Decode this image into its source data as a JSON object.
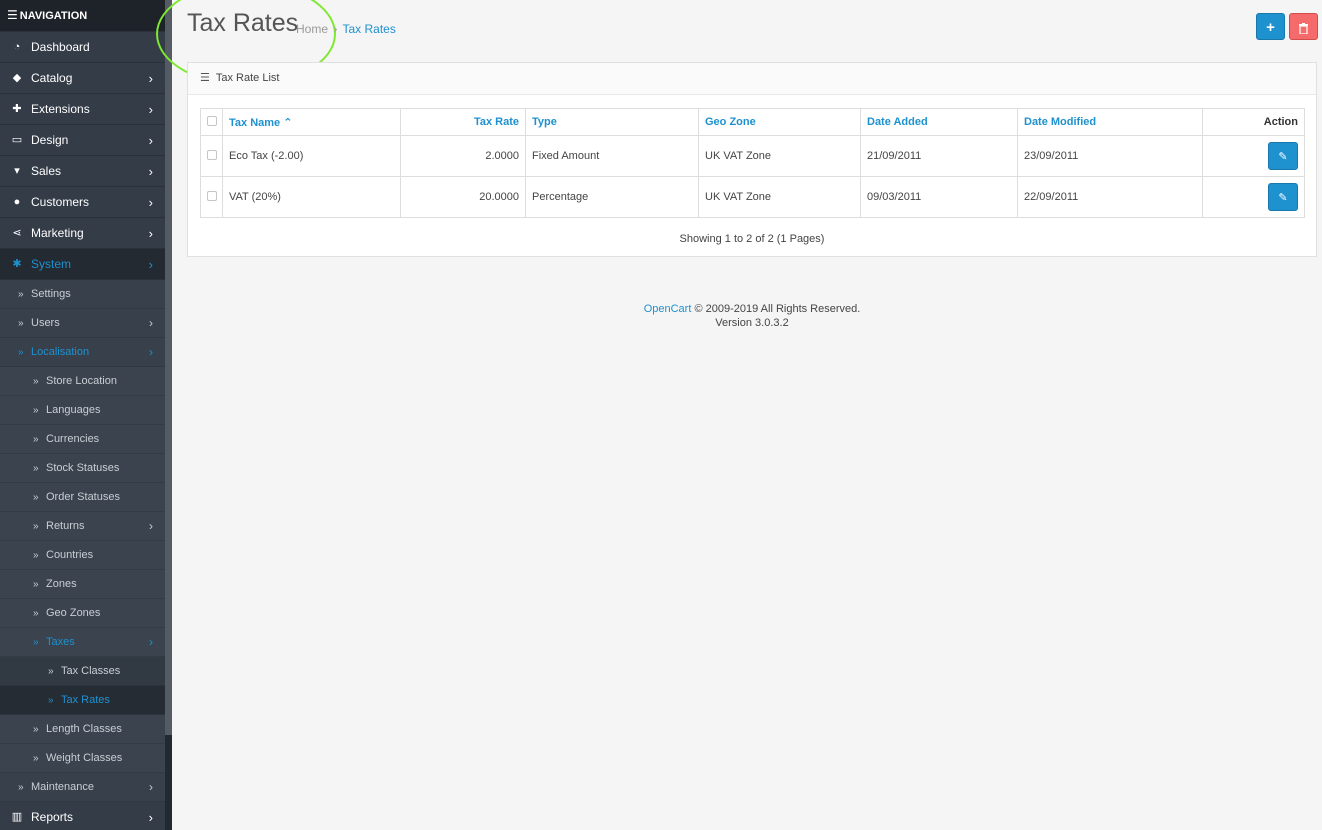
{
  "nav": {
    "title": "NAVIGATION",
    "items": [
      {
        "label": "Dashboard",
        "icon": "dashboard-icon"
      },
      {
        "label": "Catalog",
        "icon": "tags-icon"
      },
      {
        "label": "Extensions",
        "icon": "puzzle-icon"
      },
      {
        "label": "Design",
        "icon": "desktop-icon"
      },
      {
        "label": "Sales",
        "icon": "cart-icon"
      },
      {
        "label": "Customers",
        "icon": "user-icon"
      },
      {
        "label": "Marketing",
        "icon": "share-icon"
      },
      {
        "label": "System",
        "icon": "cog-icon"
      },
      {
        "label": "Reports",
        "icon": "bar-chart-icon"
      }
    ],
    "system_sub": [
      "Settings",
      "Users",
      "Localisation",
      "Maintenance"
    ],
    "localisation_sub": [
      "Store Location",
      "Languages",
      "Currencies",
      "Stock Statuses",
      "Order Statuses",
      "Returns",
      "Countries",
      "Zones",
      "Geo Zones",
      "Taxes",
      "Length Classes",
      "Weight Classes"
    ],
    "taxes_sub": [
      "Tax Classes",
      "Tax Rates"
    ]
  },
  "page": {
    "title": "Tax Rates",
    "breadcrumb": [
      "Home",
      "Tax Rates"
    ]
  },
  "panel": {
    "heading": "Tax Rate List",
    "columns": [
      "Tax Name",
      "Tax Rate",
      "Type",
      "Geo Zone",
      "Date Added",
      "Date Modified",
      "Action"
    ],
    "sort_indicator": "⌃",
    "rows": [
      {
        "name": "Eco Tax (-2.00)",
        "rate": "2.0000",
        "type": "Fixed Amount",
        "geo_zone": "UK VAT Zone",
        "date_added": "21/09/2011",
        "date_modified": "23/09/2011"
      },
      {
        "name": "VAT (20%)",
        "rate": "20.0000",
        "type": "Percentage",
        "geo_zone": "UK VAT Zone",
        "date_added": "09/03/2011",
        "date_modified": "22/09/2011"
      }
    ],
    "pagination": "Showing 1 to 2 of 2 (1 Pages)"
  },
  "footer": {
    "brand": "OpenCart",
    "copyright": " © 2009-2019 All Rights Reserved.",
    "version": "Version 3.0.3.2"
  },
  "colors": {
    "accent": "#1e91cf",
    "danger": "#f56b6b",
    "sidebar": "#2b323c",
    "highlight_ring": "#7fe832"
  }
}
